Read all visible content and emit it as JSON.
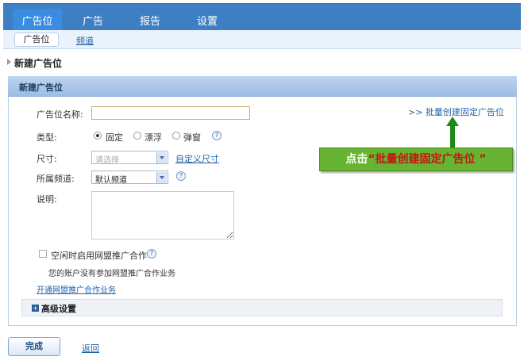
{
  "nav": {
    "tabs": [
      {
        "label": "广告位"
      },
      {
        "label": "广告"
      },
      {
        "label": "报告"
      },
      {
        "label": "设置"
      }
    ],
    "subtabs": [
      {
        "label": "广告位"
      },
      {
        "label": "频道"
      }
    ]
  },
  "page_title": "新建广告位",
  "panel": {
    "title": "新建广告位",
    "batch_link": ">> 批量创建固定广告位",
    "fields": {
      "name_label": "广告位名称:",
      "name_value": "",
      "type_label": "类型:",
      "type_options": [
        "固定",
        "漂浮",
        "弹窗"
      ],
      "type_selected": "固定",
      "size_label": "尺寸:",
      "size_placeholder": "请选择",
      "custom_size_link": "自定义尺寸",
      "channel_label": "所属频道:",
      "channel_value": "默认频道",
      "desc_label": "说明:",
      "desc_value": ""
    },
    "union": {
      "checkbox_label": "空闲时启用网盟推广合作",
      "note": "您的账户没有参加网盟推广合作业务",
      "open_link": "开通网盟推广合作业务"
    },
    "advanced": {
      "label": "高级设置",
      "expand_glyph": "+"
    }
  },
  "buttons": {
    "done": "完成",
    "back": "返回"
  },
  "callout": {
    "prefix": "点击",
    "quoted": "“批量创建固定广告位 ”"
  },
  "icons": {
    "help_glyph": "?"
  },
  "colors": {
    "nav_bg": "#3e7fc4",
    "callout_bg": "#66b431",
    "callout_quote": "#c71414",
    "arrow": "#1e8a16",
    "link": "#2463a8"
  }
}
